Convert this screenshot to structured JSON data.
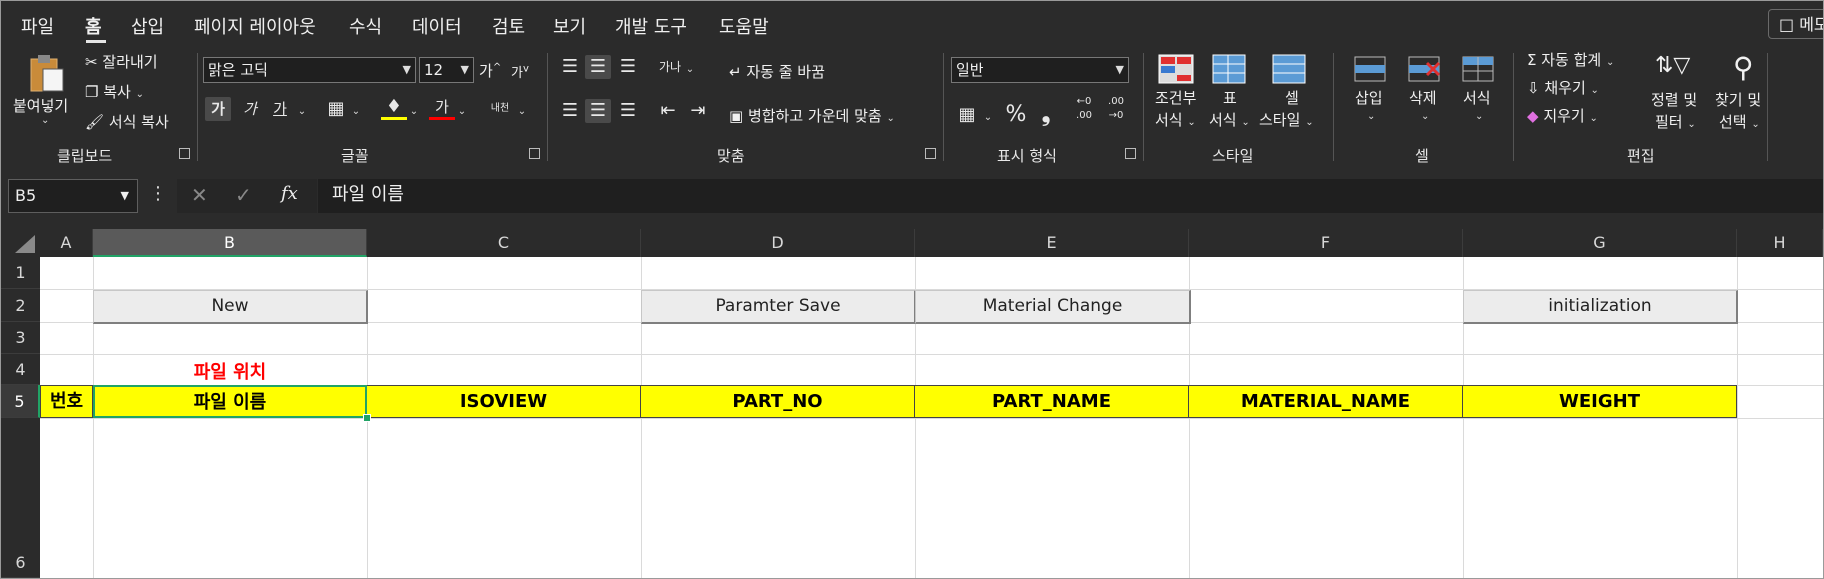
{
  "menu": {
    "tabs": [
      "파일",
      "홈",
      "삽입",
      "페이지 레이아웃",
      "수식",
      "데이터",
      "검토",
      "보기",
      "개발 도구",
      "도움말"
    ],
    "memo_label": "메모"
  },
  "ribbon": {
    "clipboard": {
      "paste": "붙여넣기",
      "cut": "잘라내기",
      "copy": "복사",
      "format_painter": "서식 복사",
      "group": "클립보드"
    },
    "font": {
      "name": "맑은 고딕",
      "size": "12",
      "grow": "가",
      "shrink": "가",
      "bold": "가",
      "italic": "가",
      "underline": "가",
      "font_color": "가",
      "phonetic": "내천",
      "group": "글꼴"
    },
    "alignment": {
      "wrap": "자동 줄 바꿈",
      "merge": "병합하고 가운데 맞춤",
      "orient_label": "가나",
      "group": "맞춤"
    },
    "number": {
      "format": "일반",
      "percent": "%",
      "comma": "❟",
      "inc": ".00",
      "dec": ".00",
      "inc_top": "←0",
      "dec_top": "→0",
      "group": "표시 형식"
    },
    "styles": {
      "conditional_1": "조건부",
      "conditional_2": "서식",
      "table_1": "표",
      "table_2": "서식",
      "cell_1": "셀",
      "cell_2": "스타일",
      "group": "스타일"
    },
    "cells": {
      "insert": "삽입",
      "delete": "삭제",
      "format": "서식",
      "group": "셀"
    },
    "editing": {
      "autosum": "자동 합계",
      "fill": "채우기",
      "clear": "지우기",
      "sort_1": "정렬 및",
      "sort_2": "필터",
      "find_1": "찾기 및",
      "find_2": "선택",
      "group": "편집"
    }
  },
  "formula_bar": {
    "name_box": "B5",
    "content": "파일 이름",
    "fx": "fx"
  },
  "grid": {
    "columns": [
      "A",
      "B",
      "C",
      "D",
      "E",
      "F",
      "G",
      "H"
    ],
    "rows": [
      "1",
      "2",
      "3",
      "4",
      "5",
      "6"
    ],
    "buttons": {
      "new": "New",
      "param_save": "Paramter Save",
      "material_change": "Material Change",
      "initialization": "initialization"
    },
    "b4": "파일 위치",
    "row5": [
      "번호",
      "파일 이름",
      "ISOVIEW",
      "PART_NO",
      "PART_NAME",
      "MATERIAL_NAME",
      "WEIGHT"
    ],
    "selected_cell": "B5"
  },
  "colors": {
    "accent_green": "#21a366",
    "highlight_yellow": "#ffff00",
    "red_text": "#ff0000",
    "ribbon_bg": "#2b2b2b"
  }
}
